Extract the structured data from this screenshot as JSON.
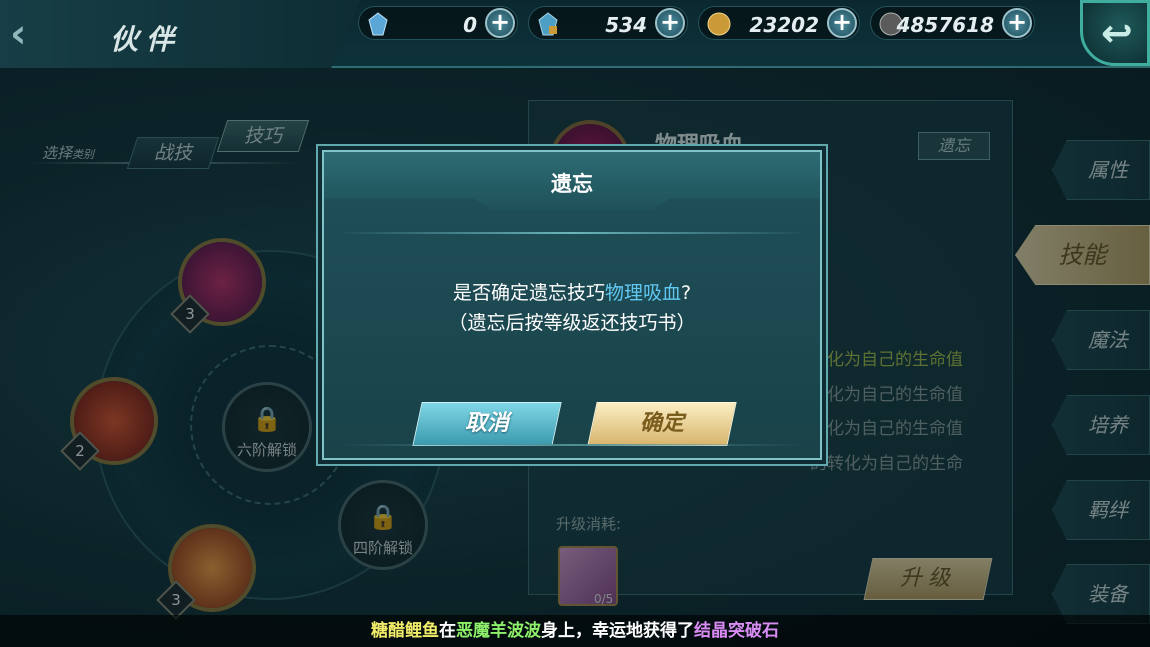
{
  "header": {
    "title": "伙伴",
    "back_chevron": "‹"
  },
  "resources": [
    {
      "icon": "blue-crystal-icon",
      "value": "0",
      "color": "#5aa6d6"
    },
    {
      "icon": "locked-crystal-icon",
      "value": "534",
      "color": "#4d9fc3"
    },
    {
      "icon": "gold-coin-icon",
      "value": "23202",
      "color": "#c99a37"
    },
    {
      "icon": "silver-coin-icon",
      "value": "4857618",
      "color": "#8a8a8a"
    }
  ],
  "plus_label": "+",
  "back_button": "↩",
  "category": {
    "label": "选择",
    "label_small": "类别",
    "tabs": [
      {
        "label": "战技"
      },
      {
        "label": "技巧"
      }
    ]
  },
  "wheel": {
    "slots": [
      {
        "level": "3",
        "color": "#7a1e6e"
      },
      {
        "level": "2",
        "color": "#b8321c"
      },
      {
        "level": "3",
        "color": "#d0561f"
      }
    ],
    "locks": [
      {
        "label": "六阶解锁"
      },
      {
        "label": "四阶解锁"
      }
    ],
    "lock_glyph": "🔒"
  },
  "panel": {
    "skill_name": "物理吸血",
    "forget_tag": "遗忘",
    "descriptions": [
      "转化为自己的生命值",
      "转化为自己的生命值",
      "转化为自己的生命值",
      "的转化为自己的生命"
    ],
    "cost_label": "升级消耗:",
    "book_count": "0/5",
    "upgrade_label": "升级"
  },
  "side_nav": [
    {
      "label": "属性"
    },
    {
      "label": "技能"
    },
    {
      "label": "魔法"
    },
    {
      "label": "培养"
    },
    {
      "label": "羁绊"
    },
    {
      "label": "装备"
    }
  ],
  "dialog": {
    "title": "遗忘",
    "line1_prefix": "是否确定遗忘技巧",
    "line1_skill": "物理吸血",
    "line1_suffix": "?",
    "line2": "（遗忘后按等级返还技巧书）",
    "cancel": "取消",
    "confirm": "确定"
  },
  "ticker": {
    "player": "糖醋鲤鱼",
    "mid1": "在",
    "place": "恶魔羊波波",
    "mid2": "身上，幸运地获得了",
    "item": "结晶突破石"
  }
}
